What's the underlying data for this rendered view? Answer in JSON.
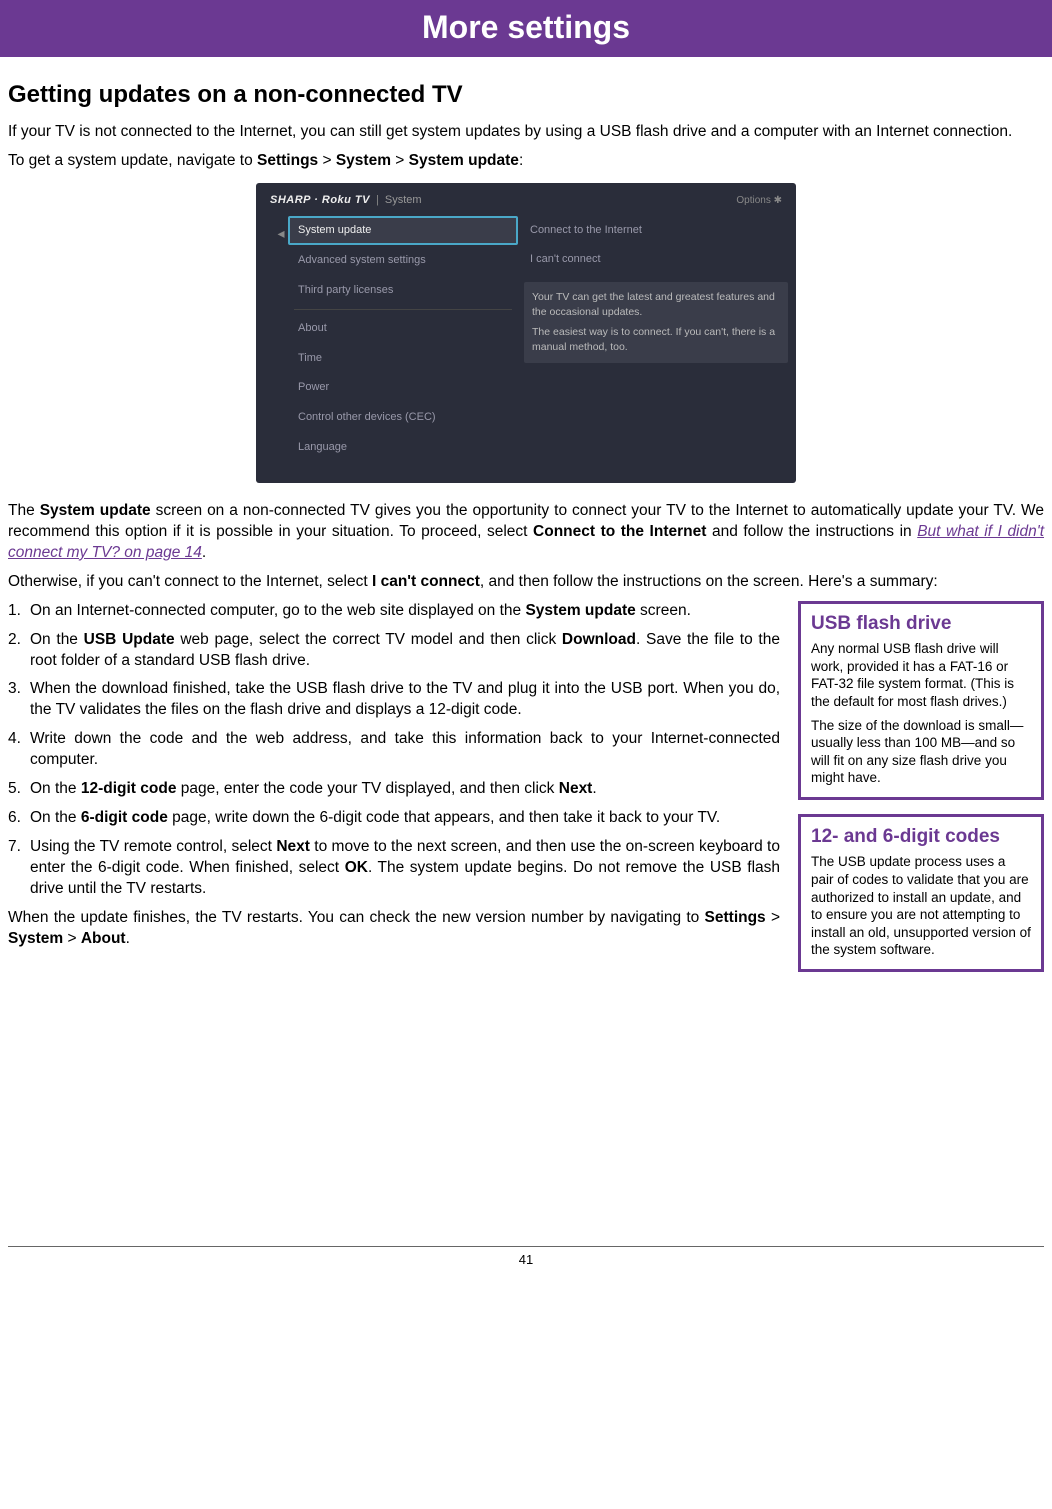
{
  "banner": "More settings",
  "title": "Getting updates on a non-connected TV",
  "intro1": "If your TV is not connected to the Internet, you can still get system updates by using a USB flash drive and a computer with an Internet connection.",
  "intro2_pre": "To get a system update, navigate to ",
  "intro2_b1": "Settings",
  "intro2_b2": "System",
  "intro2_b3": "System update",
  "gt": " > ",
  "colon": ":",
  "tv": {
    "logo": "SHARP · Roku TV",
    "crumb": "System",
    "options": "Options ✱",
    "left": [
      "System update",
      "Advanced system settings",
      "Third party licenses",
      "About",
      "Time",
      "Power",
      "Control other devices (CEC)",
      "Language"
    ],
    "right": [
      "Connect to the Internet",
      "I can't connect"
    ],
    "info1": "Your TV can get the latest and greatest features and the occasional updates.",
    "info2": "The easiest way is to connect.  If you can't, there is a manual method, too."
  },
  "para2_1": "The ",
  "para2_b1": "System update",
  "para2_2": " screen on a non-connected TV gives you the opportunity to connect your TV to the Internet to automatically update your TV. We recommend this option if it is possible in your situation. To proceed, select ",
  "para2_b2": "Connect to the Internet",
  "para2_3": " and follow the instructions in ",
  "para2_link": "But what if I didn't connect my TV? on page 14",
  "para2_4": ".",
  "para3_1": "Otherwise, if you can't connect to the Internet, select ",
  "para3_b1": "I can't connect",
  "para3_2": ", and then follow the instructions on the screen. Here's a summary:",
  "steps": {
    "s1a": "On an Internet-connected computer, go to the web site displayed on the ",
    "s1b": "System update",
    "s1c": " screen.",
    "s2a": "On the ",
    "s2b": "USB Update",
    "s2c": " web page, select the correct TV model and then click ",
    "s2d": "Download",
    "s2e": ". Save the file to the root folder of a standard USB flash drive.",
    "s3": "When the download finished, take the USB flash drive to the TV and plug it into the USB port. When you do, the TV validates the files on the flash drive and displays a 12-digit code.",
    "s4": "Write down the code and the web address, and take this information back to your Internet-connected computer.",
    "s5a": "On the ",
    "s5b": "12-digit code",
    "s5c": " page, enter the code your TV displayed, and then click ",
    "s5d": "Next",
    "s5e": ".",
    "s6a": "On the ",
    "s6b": "6-digit code",
    "s6c": " page, write down the 6-digit code that appears, and then take it back to your TV.",
    "s7a": "Using the TV remote control, select ",
    "s7b": "Next",
    "s7c": " to move to the next screen, and then use the on-screen keyboard to enter the 6-digit code. When finished, select ",
    "s7d": "OK",
    "s7e": ". The system update begins. Do not remove the USB flash drive until the TV restarts."
  },
  "closing_1": "When the update finishes, the TV restarts. You can check the new version number by navigating to ",
  "closing_b1": "Settings",
  "closing_b2": "System",
  "closing_b3": "About",
  "closing_2": ".",
  "callout1": {
    "title": "USB flash drive",
    "p1": "Any normal USB flash drive will work, provided it has a FAT-16 or FAT-32 file system format. (This is the default for most flash drives.)",
    "p2": "The size of the download is small—usually less than 100 MB—and so will fit on any size flash drive you might have."
  },
  "callout2": {
    "title": "12- and 6-digit codes",
    "p1": "The USB update process uses a pair of codes to validate that you are authorized to install an update, and to ensure you are not attempting to install an old, unsupported version of the system software."
  },
  "page_number": "41"
}
